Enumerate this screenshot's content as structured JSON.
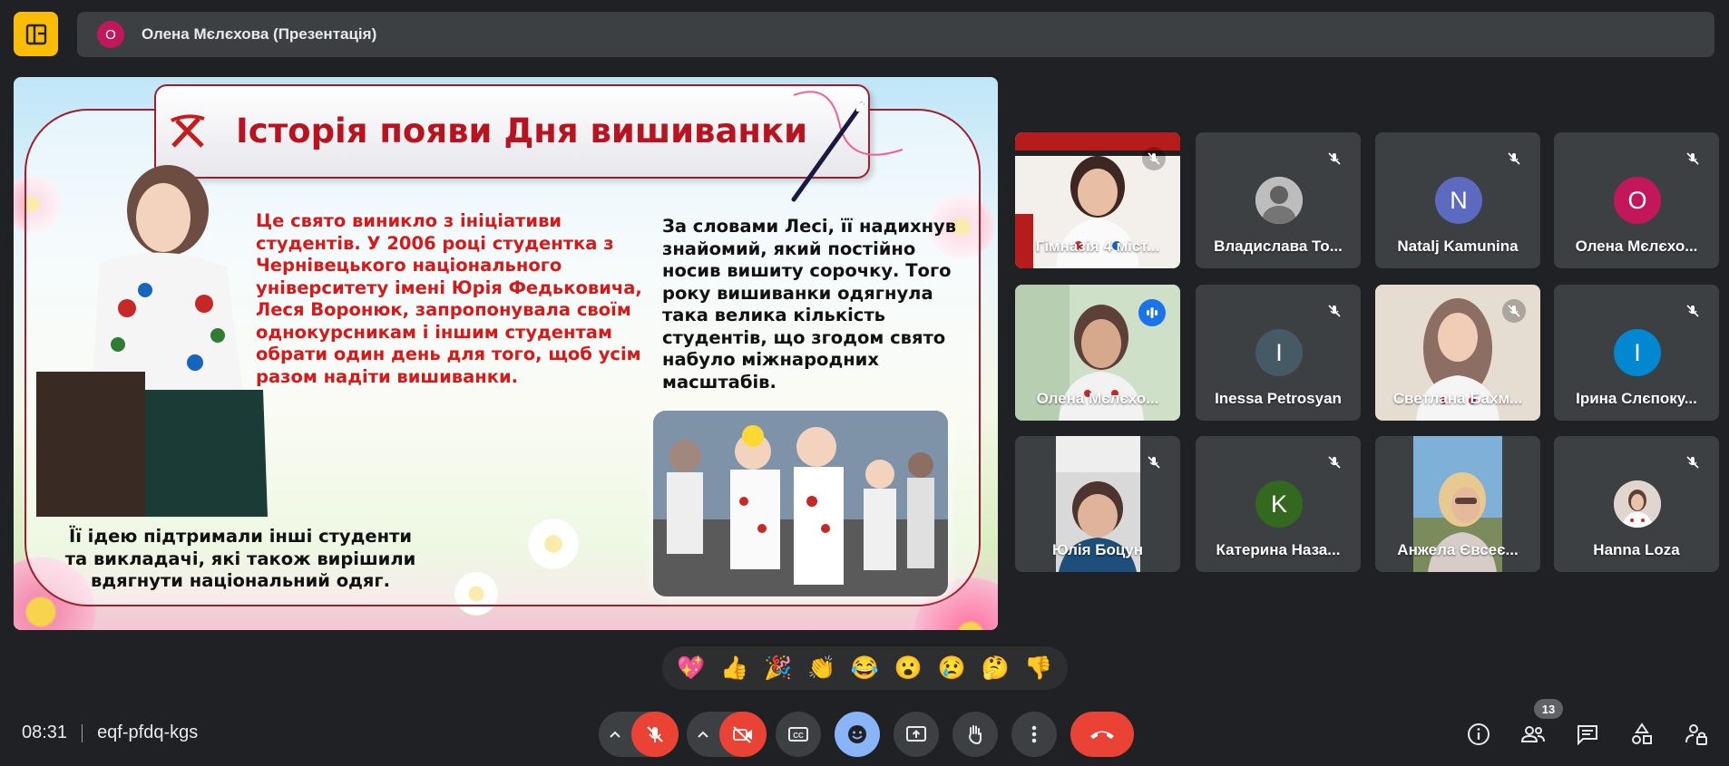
{
  "presenter": {
    "avatar_letter": "О",
    "name": "Олена Мєлєхова (Презентація)"
  },
  "slide": {
    "title": "Історія появи Дня вишиванки",
    "paragraph_left": "Це свято виникло з ініціативи студентів. У 2006 році студентка з Чернівецького національного університету імені Юрія Федьковича, Леся Воронюк, запропонувала своїм однокурсникам і іншим студентам обрати один день для того, щоб усім разом надіти вишиванки.",
    "paragraph_right": "За словами Лесі, її надихнув знайомий, який постійно носив вишиту сорочку. Того року вишиванки одягнула така велика кількість студентів, що згодом свято набуло міжнародних масштабів.",
    "paragraph_bottom": "Її ідею підтримали інші студенти та викладачі, які також вирішили вдягнути національний одяг."
  },
  "participants": [
    {
      "name": "Гімназія 4 міст...",
      "type": "video",
      "muted": true
    },
    {
      "name": "Владислава То...",
      "type": "photo",
      "muted": true
    },
    {
      "name": "Natalj Kamunina",
      "type": "letter",
      "letter": "N",
      "color": "#5c6bc0",
      "muted": true
    },
    {
      "name": "Олена Мєлєхо...",
      "type": "letter",
      "letter": "О",
      "color": "#c2185b",
      "muted": true
    },
    {
      "name": "Олена Мєлєхо...",
      "type": "video",
      "muted": false,
      "speaking": true
    },
    {
      "name": "Inessa Petrosyan",
      "type": "letter",
      "letter": "I",
      "color": "#455a64",
      "muted": true
    },
    {
      "name": "Светлана Бахм...",
      "type": "video",
      "muted": true
    },
    {
      "name": "Ірина Слєпоку...",
      "type": "letter",
      "letter": "І",
      "color": "#0288d1",
      "muted": true
    },
    {
      "name": "Юлія Боцун",
      "type": "video",
      "muted": true
    },
    {
      "name": "Катерина Наза...",
      "type": "letter",
      "letter": "K",
      "color": "#33691e",
      "muted": true
    },
    {
      "name": "Анжела Євсеє...",
      "type": "video",
      "muted": false
    },
    {
      "name": "Hanna Loza",
      "type": "photo",
      "muted": true
    }
  ],
  "reactions": [
    "💖",
    "👍",
    "🎉",
    "👏",
    "😂",
    "😮",
    "😢",
    "🤔",
    "👎"
  ],
  "meeting": {
    "time": "08:31",
    "code": "eqf-pfdq-kgs",
    "participant_count": "13"
  },
  "colors": {
    "background": "#202124",
    "tile": "#3c4043",
    "danger": "#ea4335",
    "accent": "#8ab4f8",
    "logo": "#fbbc04"
  }
}
